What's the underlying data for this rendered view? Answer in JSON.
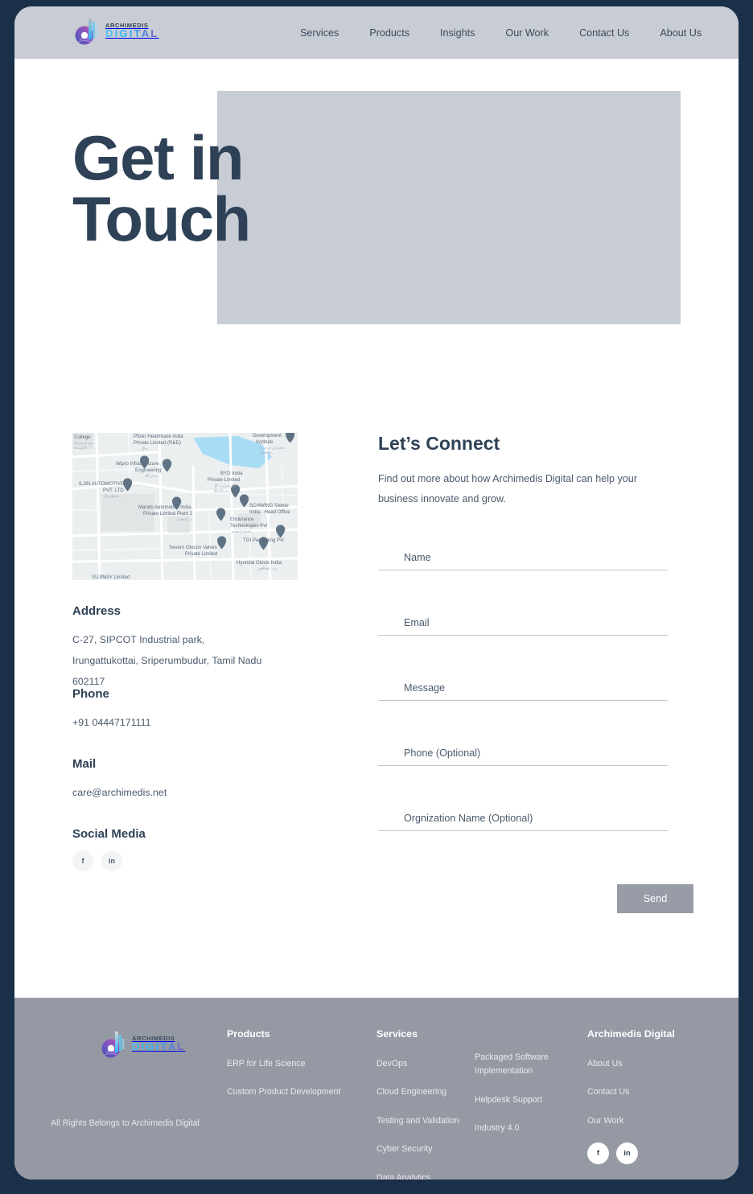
{
  "brand": {
    "name_top": "ARCHIMEDIS",
    "name_bottom": "DIGITAL"
  },
  "header": {
    "nav": [
      {
        "label": "Services"
      },
      {
        "label": "Products"
      },
      {
        "label": "Insights"
      },
      {
        "label": "Our Work"
      },
      {
        "label": "Contact Us"
      },
      {
        "label": "About Us"
      }
    ]
  },
  "hero": {
    "title": "Get in Touch"
  },
  "contact_info": {
    "map_name": "map-thumbnail",
    "map_places": [
      "College",
      "Pfizer Healthcare India Private Limited (R&D)",
      "Development Institute",
      "Wipro Infrastructure Engineering",
      "BYD India Private Limited",
      "ILJIN AUTOMOTIVE PVT. LTD",
      "Mando Automotive India Private Limited Plant 2",
      "SCHWING Stetter India - Head Office",
      "Endurance Technologies Pvt",
      "TGI Packaging Pvt",
      "Severn Glocon Valves Private Limited",
      "Hyundai Glovis India",
      "SUJIMAY Limited"
    ],
    "address_heading": "Address",
    "address_lines": [
      "C-27, SIPCOT Industrial park,",
      "Irungattukottai, Sriperumbudur, Tamil Nadu",
      "602117"
    ],
    "phone_heading": "Phone",
    "phone_value": "+91 04447171111",
    "mail_heading": "Mail",
    "mail_value": "care@archimedis.net",
    "social_heading": "Social Media",
    "social": [
      {
        "icon": "facebook-icon",
        "glyph": "f"
      },
      {
        "icon": "linkedin-icon",
        "glyph": "in"
      }
    ]
  },
  "form": {
    "title": "Let’s Connect",
    "subtitle": "Find out more about how Archimedis Digital can help your business innovate and grow.",
    "fields": [
      {
        "name": "name",
        "placeholder": "Name",
        "value": ""
      },
      {
        "name": "email",
        "placeholder": "Email",
        "value": ""
      },
      {
        "name": "message",
        "placeholder": "Message",
        "value": ""
      },
      {
        "name": "phone",
        "placeholder": "Phone (Optional)",
        "value": ""
      },
      {
        "name": "organization",
        "placeholder": "Orgnization Name (Optional)",
        "value": ""
      }
    ],
    "submit_label": "Send"
  },
  "footer": {
    "copyright": "All Rights Belongs to Archimedis Digital",
    "products": {
      "heading": "Products",
      "links": [
        {
          "label": "ERP for Life Science"
        },
        {
          "label": "Custom Product Development"
        }
      ]
    },
    "services": {
      "heading": "Services",
      "links": [
        {
          "label": "DevOps"
        },
        {
          "label": "Cloud Engineering"
        },
        {
          "label": "Testing and Validation"
        },
        {
          "label": "Cyber Security"
        },
        {
          "label": "Data Analytics"
        }
      ]
    },
    "services2": {
      "links": [
        {
          "label": "Packaged Software Implementation"
        },
        {
          "label": "Helpdesk Support"
        },
        {
          "label": "Industry 4.0"
        }
      ]
    },
    "company": {
      "heading": "Archimedis Digital",
      "links": [
        {
          "label": "About Us"
        },
        {
          "label": "Contact Us"
        },
        {
          "label": "Our Work"
        }
      ],
      "social": [
        {
          "icon": "facebook-icon",
          "glyph": "f"
        },
        {
          "icon": "linkedin-icon",
          "glyph": "in"
        }
      ]
    }
  },
  "colors": {
    "navy": "#2e4156",
    "header_bg": "#c8ccd4",
    "footer_bg": "#9599a4",
    "frame": "#1a3048",
    "send_bg": "#979ca7",
    "accent_cyan": "#29b6f6",
    "accent_purple": "#7e57c2"
  }
}
